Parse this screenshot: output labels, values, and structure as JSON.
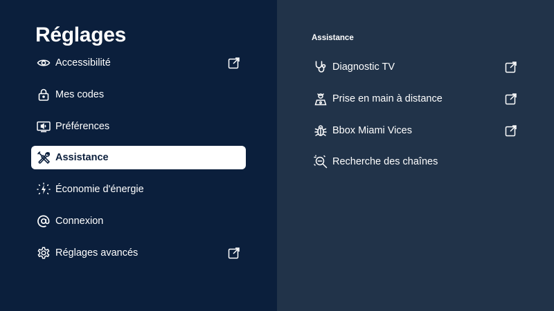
{
  "page": {
    "title": "Réglages"
  },
  "menu": {
    "items": [
      {
        "label": "Accessibilité",
        "icon": "eye-icon",
        "external": true
      },
      {
        "label": "Mes codes",
        "icon": "lock-icon",
        "external": false
      },
      {
        "label": "Préférences",
        "icon": "tv-sound-icon",
        "external": false
      },
      {
        "label": "Assistance",
        "icon": "tools-icon",
        "external": false,
        "selected": true
      },
      {
        "label": "Économie d'énergie",
        "icon": "energy-icon",
        "external": false
      },
      {
        "label": "Connexion",
        "icon": "at-icon",
        "external": false
      },
      {
        "label": "Réglages avancés",
        "icon": "gear-icon",
        "external": true
      }
    ]
  },
  "assistance": {
    "title": "Assistance",
    "items": [
      {
        "label": "Diagnostic TV",
        "icon": "stethoscope-icon",
        "external": true
      },
      {
        "label": "Prise en main à distance",
        "icon": "remote-support-icon",
        "external": true
      },
      {
        "label": "Bbox Miami Vices",
        "icon": "bug-icon",
        "external": true
      },
      {
        "label": "Recherche des chaînes",
        "icon": "channel-search-icon",
        "external": false
      }
    ]
  },
  "colors": {
    "left_bg": "#0b1f3c",
    "right_bg": "#213349",
    "selected_bg": "#ffffff",
    "selected_text": "#0b1f3c"
  }
}
